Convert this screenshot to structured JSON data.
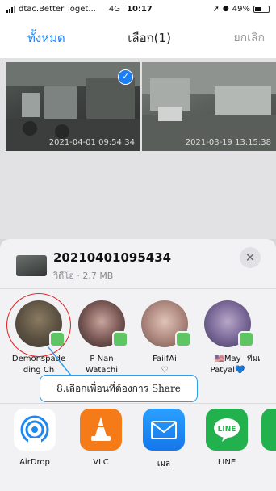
{
  "status_bar": {
    "carrier": "dtac.Better Toget...",
    "network": "4G",
    "time": "10:17",
    "battery": "49%",
    "battery_level": 0.49
  },
  "nav": {
    "select_all": "ทั้งหมด",
    "title": "เลือก(1)",
    "cancel": "ยกเลิก"
  },
  "photos": [
    {
      "timestamp": "2021-04-01 09:54:34",
      "selected": true
    },
    {
      "timestamp": "2021-03-19 13:15:38",
      "selected": false
    }
  ],
  "share_sheet": {
    "file_name": "20210401095434",
    "file_meta": "วิดีโอ · 2.7 MB",
    "close_glyph": "✕",
    "contacts": [
      {
        "name": "Demonspade\nding Ch"
      },
      {
        "name": "P Nan\nWatachi"
      },
      {
        "name": "FaiifAi\n♡"
      },
      {
        "name": "🇺🇸May\nPatyal💙"
      },
      {
        "name": "ทีมเ"
      }
    ],
    "apps": [
      {
        "label": "AirDrop",
        "color": "#ffffff",
        "icon": "airdrop-icon"
      },
      {
        "label": "VLC",
        "color": "#f47b18",
        "icon": "vlc-cone-icon"
      },
      {
        "label": "เมล",
        "color": "#1f8cf5",
        "icon": "mail-icon"
      },
      {
        "label": "LINE",
        "color": "#22b14c",
        "icon": "line-icon"
      }
    ]
  },
  "annotation": {
    "text": "8.เลือกเพื่อนที่ต้องการ Share"
  },
  "colors": {
    "accent": "#1a7ef5",
    "annotation_ring": "#e02020",
    "callout_border": "#2f9de8"
  }
}
